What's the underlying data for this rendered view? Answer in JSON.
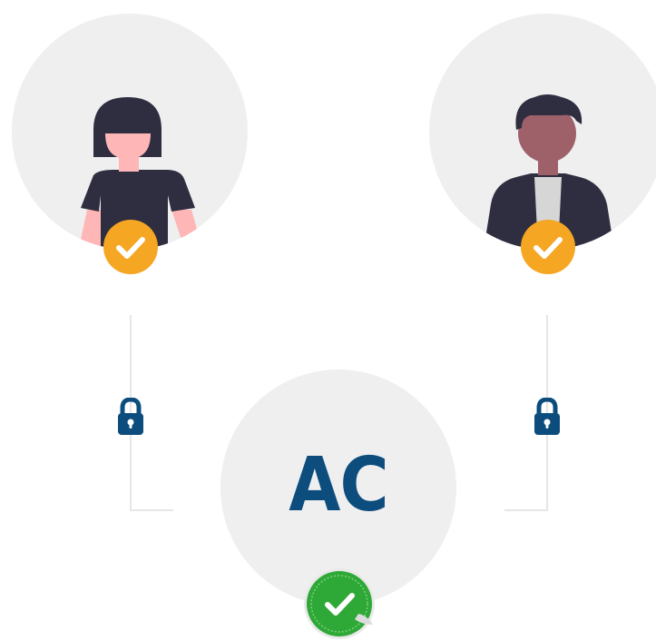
{
  "nodes": {
    "ac_label": "AC"
  },
  "icons": {
    "user_left": "woman-avatar-icon",
    "user_right": "man-avatar-icon",
    "badge": "check-icon",
    "lock": "lock-icon",
    "seal": "verified-check-icon"
  },
  "colors": {
    "circle_fill": "#efefef",
    "badge_orange": "#f5a623",
    "lock_blue": "#0c4d7e",
    "ac_blue": "#0c4d7e",
    "seal_green": "#2ea836",
    "connector_gray": "#e6e6e6",
    "figure_dark": "#2f2e41",
    "skin_light": "#ffb6b6",
    "skin_dark": "#9e616a"
  }
}
